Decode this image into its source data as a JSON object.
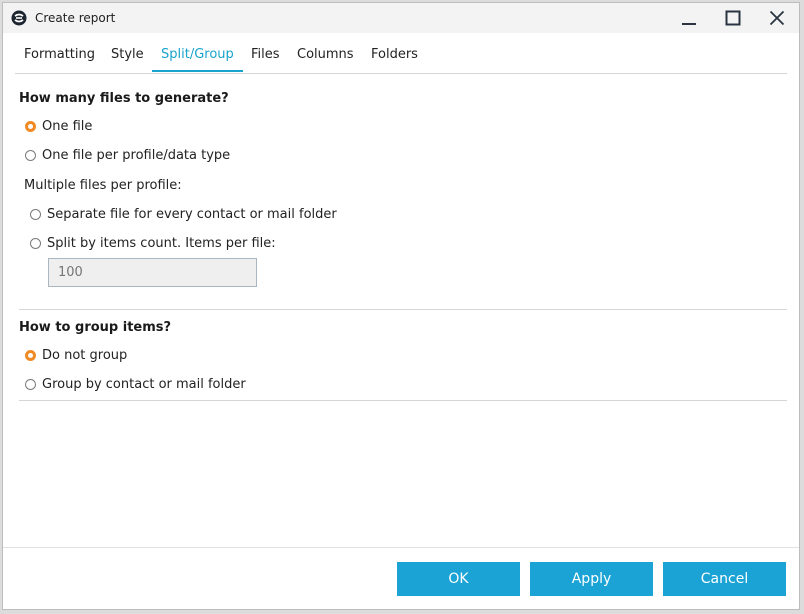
{
  "window": {
    "title": "Create report",
    "accent_color": "#1aa3cc",
    "radio_selected_color": "#f08a24"
  },
  "tabs": [
    {
      "label": "Formatting",
      "active": false
    },
    {
      "label": "Style",
      "active": false
    },
    {
      "label": "Split/Group",
      "active": true
    },
    {
      "label": "Files",
      "active": false
    },
    {
      "label": "Columns",
      "active": false
    },
    {
      "label": "Folders",
      "active": false
    }
  ],
  "split": {
    "title": "How many files to generate?",
    "options": [
      {
        "label": "One file",
        "checked": true
      },
      {
        "label": "One file per profile/data type",
        "checked": false
      }
    ],
    "multiple_label": "Multiple files per profile:",
    "multiple_options": [
      {
        "label": "Separate file for every contact or mail folder",
        "checked": false
      },
      {
        "label": "Split by items count. Items per file:",
        "checked": false
      }
    ],
    "items_per_file_placeholder": "100"
  },
  "group": {
    "title": "How to group items?",
    "options": [
      {
        "label": "Do not group",
        "checked": true
      },
      {
        "label": "Group by contact or mail folder",
        "checked": false
      }
    ]
  },
  "buttons": {
    "ok": "OK",
    "apply": "Apply",
    "cancel": "Cancel"
  }
}
